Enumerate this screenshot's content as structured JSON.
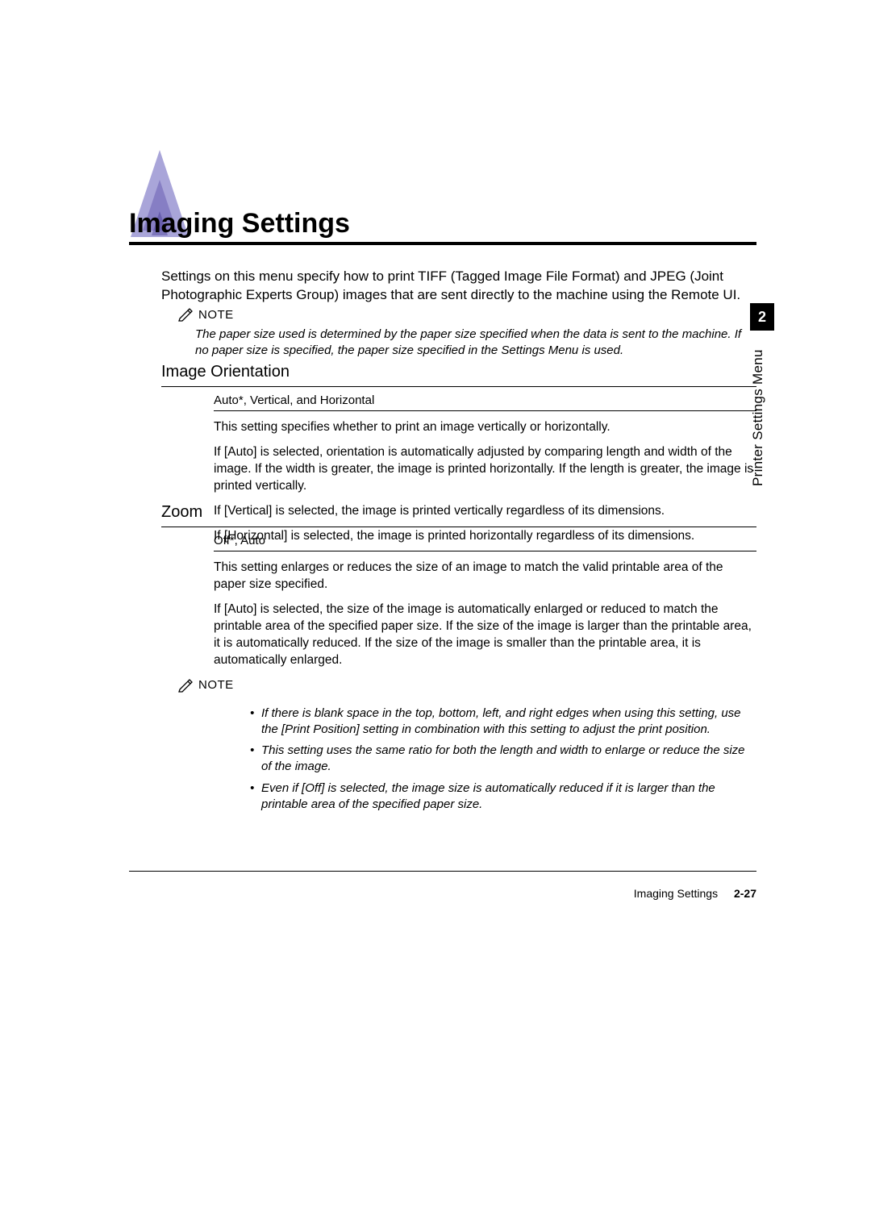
{
  "chapter": {
    "title": "Imaging Settings",
    "tab_number": "2",
    "side_label": "Printer Settings Menu"
  },
  "intro": "Settings on this menu specify how to print TIFF (Tagged Image File Format) and JPEG (Joint Photographic Experts Group) images that are sent directly to the machine using the Remote UI.",
  "note1": {
    "label": "NOTE",
    "text": "The paper size used is determined by the paper size specified when the data is sent to the machine. If no paper size is specified, the paper size specified in the Settings Menu is used."
  },
  "section_orientation": {
    "heading": "Image Orientation",
    "options": "Auto*, Vertical, and Horizontal",
    "p1": "This setting specifies whether to print an image vertically or horizontally.",
    "p2": "If [Auto] is selected, orientation is automatically adjusted by comparing length and width of the image. If the width is greater, the image is printed horizontally. If the length is greater, the image is printed vertically.",
    "p3": "If [Vertical] is selected, the image is printed vertically regardless of its dimensions.",
    "p4": "If [Horizontal] is selected, the image is printed horizontally regardless of its dimensions."
  },
  "section_zoom": {
    "heading": "Zoom",
    "options": "Off*, Auto",
    "p1": "This setting enlarges or reduces the size of an image to match the valid printable area of the paper size specified.",
    "p2": "If [Auto] is selected, the size of the image is automatically enlarged or reduced to match the printable area of the specified paper size. If the size of the image is larger than the printable area, it is automatically reduced. If the size of the image is smaller than the printable area, it is automatically enlarged.",
    "note_label": "NOTE",
    "bullets": [
      "If there is blank space in the top, bottom, left, and right edges when using this setting, use the [Print Position] setting in combination with this setting to adjust the print position.",
      "This setting uses the same ratio for both the length and width to enlarge or reduce the size of the image.",
      "Even if [Off] is selected, the image size is automatically reduced if it is larger than the printable area of the specified paper size."
    ]
  },
  "footer": {
    "section": "Imaging Settings",
    "page": "2-27"
  }
}
